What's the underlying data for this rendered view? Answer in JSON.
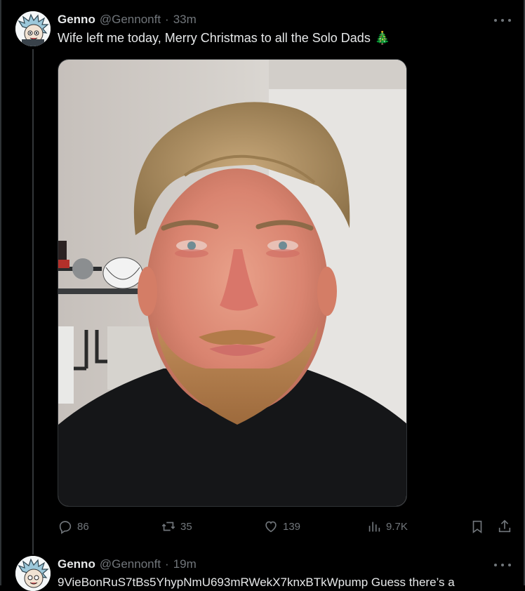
{
  "tweet": {
    "author_name": "Genno",
    "author_handle": "@Gennonft",
    "separator": "·",
    "time": "33m",
    "text": "Wife left me today, Merry Christmas to all the Solo Dads",
    "emoji": "🎄",
    "image_alt": "man with red eyes",
    "stats": {
      "replies": "86",
      "reposts": "35",
      "likes": "139",
      "views": "9.7K"
    }
  },
  "reply": {
    "author_name": "Genno",
    "author_handle": "@Gennonft",
    "separator": "·",
    "time": "19m",
    "text": "9VieBonRuS7tBs5YhypNmU693mRWekX7knxBTkWpump Guess there’s a"
  },
  "icons": {
    "more": "more-horizontal-icon",
    "reply": "reply-icon",
    "repost": "repost-icon",
    "like": "heart-icon",
    "views": "bar-chart-icon",
    "bookmark": "bookmark-icon",
    "share": "share-icon"
  },
  "colors": {
    "background": "#000000",
    "text": "#e7e9ea",
    "muted": "#71767b",
    "border": "#2f3336"
  }
}
